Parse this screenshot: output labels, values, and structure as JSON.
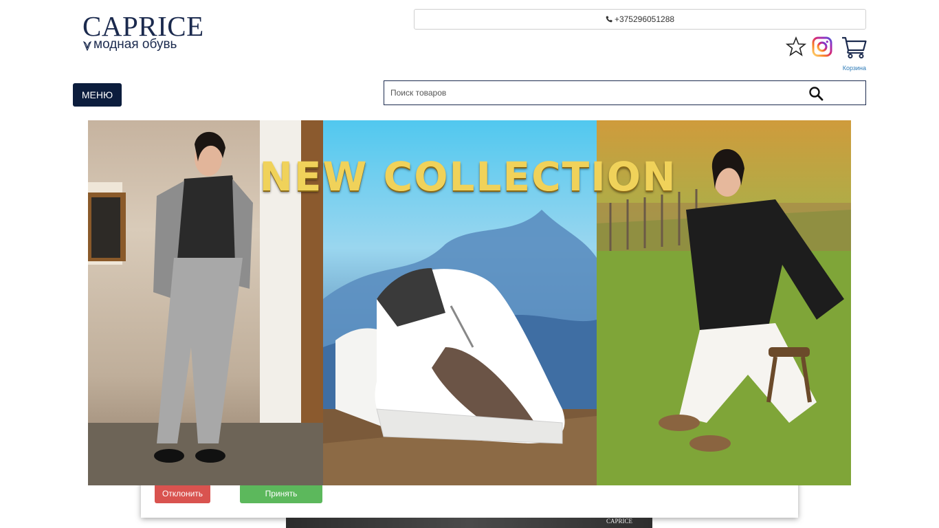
{
  "header": {
    "logo_main": "CAPRICE",
    "logo_sub": "модная обувь",
    "phone": "+375296051288",
    "cart_label": "Корзина"
  },
  "icons": [
    "phone-icon",
    "star-icon",
    "instagram-icon",
    "cart-icon",
    "search-icon"
  ],
  "nav": {
    "menu_label": "МЕНЮ"
  },
  "search": {
    "placeholder": "Поиск товаров"
  },
  "banner": {
    "title": "NEW COLLECTION"
  },
  "consent": {
    "decline_label": "Отклонить",
    "accept_label": "Принять"
  },
  "footer_strip": {
    "logo": "CAPRICE"
  },
  "colors": {
    "brand_navy": "#0c1d3d",
    "decline": "#d9534f",
    "accept": "#5cb85c",
    "cart_label": "#2f7cb8"
  }
}
